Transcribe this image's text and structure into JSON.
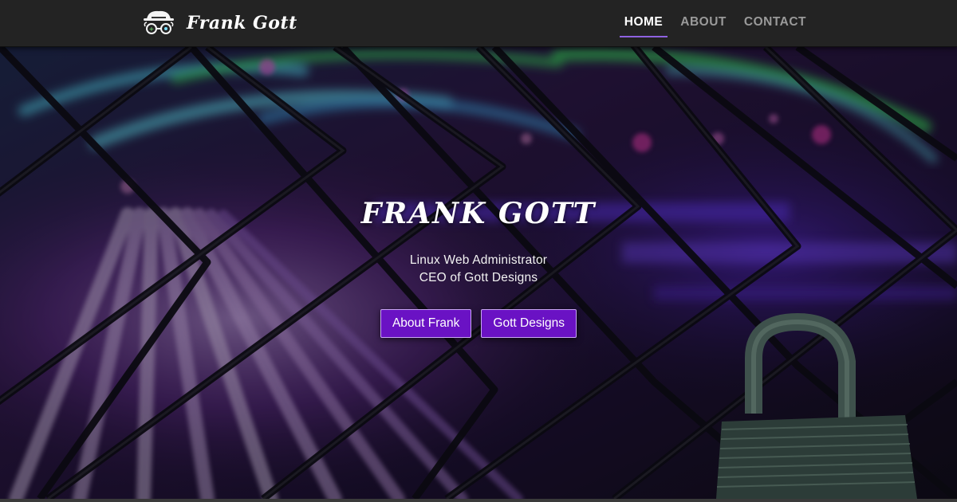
{
  "nav": {
    "brand": "Frank Gott",
    "links": [
      {
        "label": "HOME",
        "active": true
      },
      {
        "label": "ABOUT",
        "active": false
      },
      {
        "label": "CONTACT",
        "active": false
      }
    ]
  },
  "hero": {
    "title": "FRANK GOTT",
    "lines": [
      "Linux Web Administrator",
      "CEO of Gott Designs"
    ],
    "buttons": [
      "About Frank",
      "Gott Designs"
    ],
    "background": "chain-link-fence-padlock-neon-lights-photo"
  },
  "colors": {
    "accent": "#8e62e0",
    "button": "#6a12c4",
    "navbar": "#232323"
  },
  "icons": {
    "brand_logo": "hacker-hat-glasses-icon"
  }
}
